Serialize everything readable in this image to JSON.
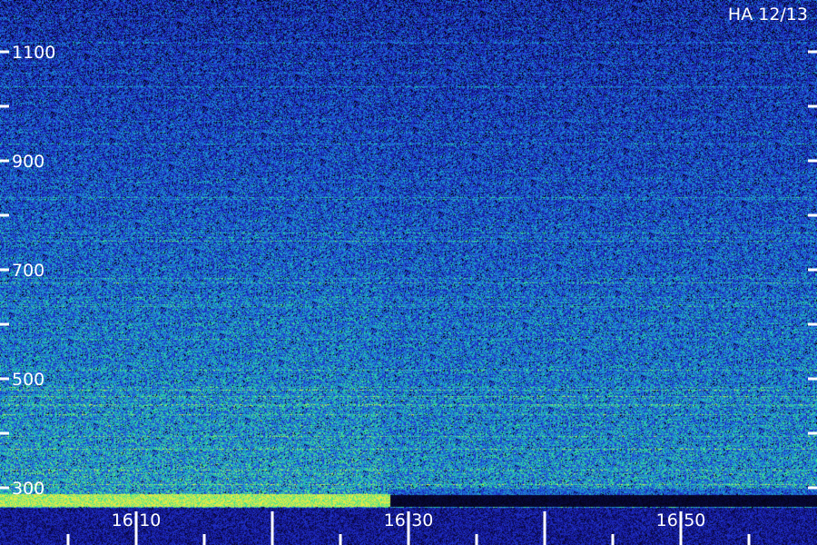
{
  "chart_data": {
    "type": "heatmap",
    "title": "HA 12/13",
    "xlabel": "",
    "ylabel": "",
    "x_ticks": [
      "16:10",
      "16:30",
      "16:50"
    ],
    "y_ticks": [
      "1100",
      "900",
      "700",
      "500",
      "300"
    ],
    "x_range": [
      "16:02",
      "16:58"
    ],
    "y_range": [
      280,
      1190
    ],
    "colormap": [
      "#000000",
      "#1a1aa0",
      "#2848d8",
      "#18a8d8",
      "#30e890",
      "#f0f040"
    ],
    "bands": [
      {
        "from": 280,
        "to": 300,
        "intensity": "high",
        "time_end": "16:28"
      }
    ],
    "grid": false
  }
}
